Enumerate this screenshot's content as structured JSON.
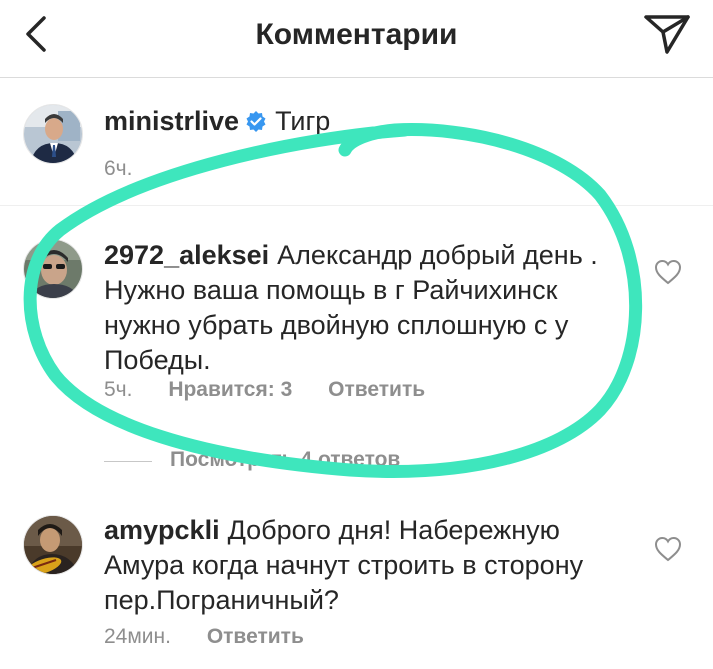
{
  "header": {
    "title": "Комментарии",
    "back_icon": "chevron-left-icon",
    "send_icon": "paper-plane-icon"
  },
  "post": {
    "username": "ministrlive",
    "verified": true,
    "caption": "Тигр",
    "time": "6ч."
  },
  "comments": [
    {
      "username": "2972_aleksei",
      "text": "Александр добрый день . Нужно ваша помощь в г Райчихинск нужно убрать двойную сплошную с у Победы.",
      "time": "5ч.",
      "likes": "Нравится: 3",
      "reply": "Ответить",
      "view_replies": "Посмотреть 4 ответов"
    },
    {
      "username": "amypckli",
      "text": "Доброго дня! Набережную Амура когда начнут строить в сторону пер.Пограничный?",
      "time": "24мин.",
      "reply": "Ответить"
    }
  ],
  "colors": {
    "highlight": "#3ee6bd",
    "verified": "#3897f0",
    "meta_text": "#8e8e8e",
    "text": "#262626"
  }
}
